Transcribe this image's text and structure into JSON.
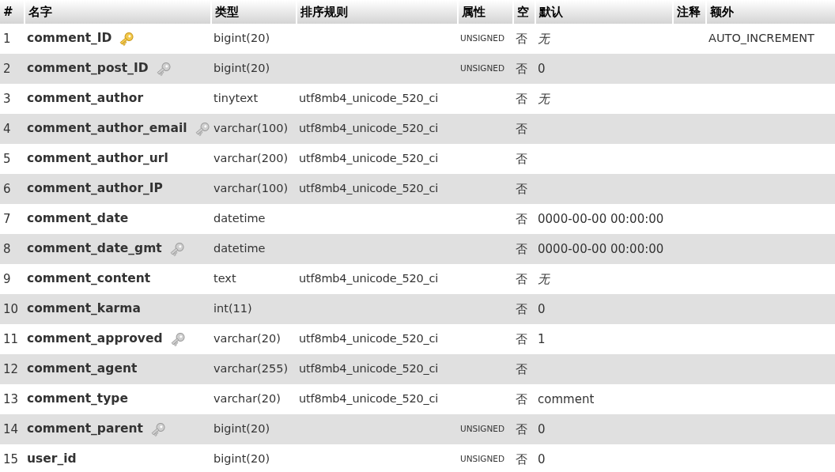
{
  "table": {
    "columns": [
      "#",
      "名字",
      "类型",
      "排序规则",
      "属性",
      "空",
      "默认",
      "注释",
      "额外"
    ],
    "rows": [
      {
        "kind": "primary",
        "index": "1",
        "name": "comment_ID",
        "type": "bigint(20)",
        "attributes": "UNSIGNED",
        "null": "否",
        "default": "无",
        "default_italic": true,
        "extra": "AUTO_INCREMENT"
      },
      {
        "kind": "indexed",
        "index": "2",
        "name": "comment_post_ID",
        "type": "bigint(20)",
        "attributes": "UNSIGNED",
        "null": "否",
        "default": "0",
        "default_italic": false
      },
      {
        "kind": "plain",
        "index": "3",
        "name": "comment_author",
        "type": "tinytext",
        "collation": "utf8mb4_unicode_520_ci",
        "null": "否",
        "default": "无",
        "default_italic": true
      },
      {
        "kind": "indexed",
        "index": "4",
        "name": "comment_author_email",
        "type": "varchar(100)",
        "collation": "utf8mb4_unicode_520_ci",
        "null": "否"
      },
      {
        "kind": "plain",
        "index": "5",
        "name": "comment_author_url",
        "type": "varchar(200)",
        "collation": "utf8mb4_unicode_520_ci",
        "null": "否"
      },
      {
        "kind": "plain",
        "index": "6",
        "name": "comment_author_IP",
        "type": "varchar(100)",
        "collation": "utf8mb4_unicode_520_ci",
        "null": "否"
      },
      {
        "kind": "plain",
        "index": "7",
        "name": "comment_date",
        "type": "datetime",
        "null": "否",
        "default": "0000-00-00 00:00:00",
        "default_italic": false
      },
      {
        "kind": "indexed",
        "index": "8",
        "name": "comment_date_gmt",
        "type": "datetime",
        "null": "否",
        "default": "0000-00-00 00:00:00",
        "default_italic": false
      },
      {
        "kind": "plain",
        "index": "9",
        "name": "comment_content",
        "type": "text",
        "collation": "utf8mb4_unicode_520_ci",
        "null": "否",
        "default": "无",
        "default_italic": true
      },
      {
        "kind": "plain",
        "index": "10",
        "name": "comment_karma",
        "type": "int(11)",
        "null": "否",
        "default": "0",
        "default_italic": false
      },
      {
        "kind": "indexed",
        "index": "11",
        "name": "comment_approved",
        "type": "varchar(20)",
        "collation": "utf8mb4_unicode_520_ci",
        "null": "否",
        "default": "1",
        "default_italic": false
      },
      {
        "kind": "plain",
        "index": "12",
        "name": "comment_agent",
        "type": "varchar(255)",
        "collation": "utf8mb4_unicode_520_ci",
        "null": "否"
      },
      {
        "kind": "plain",
        "index": "13",
        "name": "comment_type",
        "type": "varchar(20)",
        "collation": "utf8mb4_unicode_520_ci",
        "null": "否",
        "default": "comment",
        "default_italic": false
      },
      {
        "kind": "indexed",
        "index": "14",
        "name": "comment_parent",
        "type": "bigint(20)",
        "attributes": "UNSIGNED",
        "null": "否",
        "default": "0",
        "default_italic": false
      },
      {
        "kind": "plain",
        "index": "15",
        "name": "user_id",
        "type": "bigint(20)",
        "attributes": "UNSIGNED",
        "null": "否",
        "default": "0",
        "default_italic": false
      }
    ]
  }
}
